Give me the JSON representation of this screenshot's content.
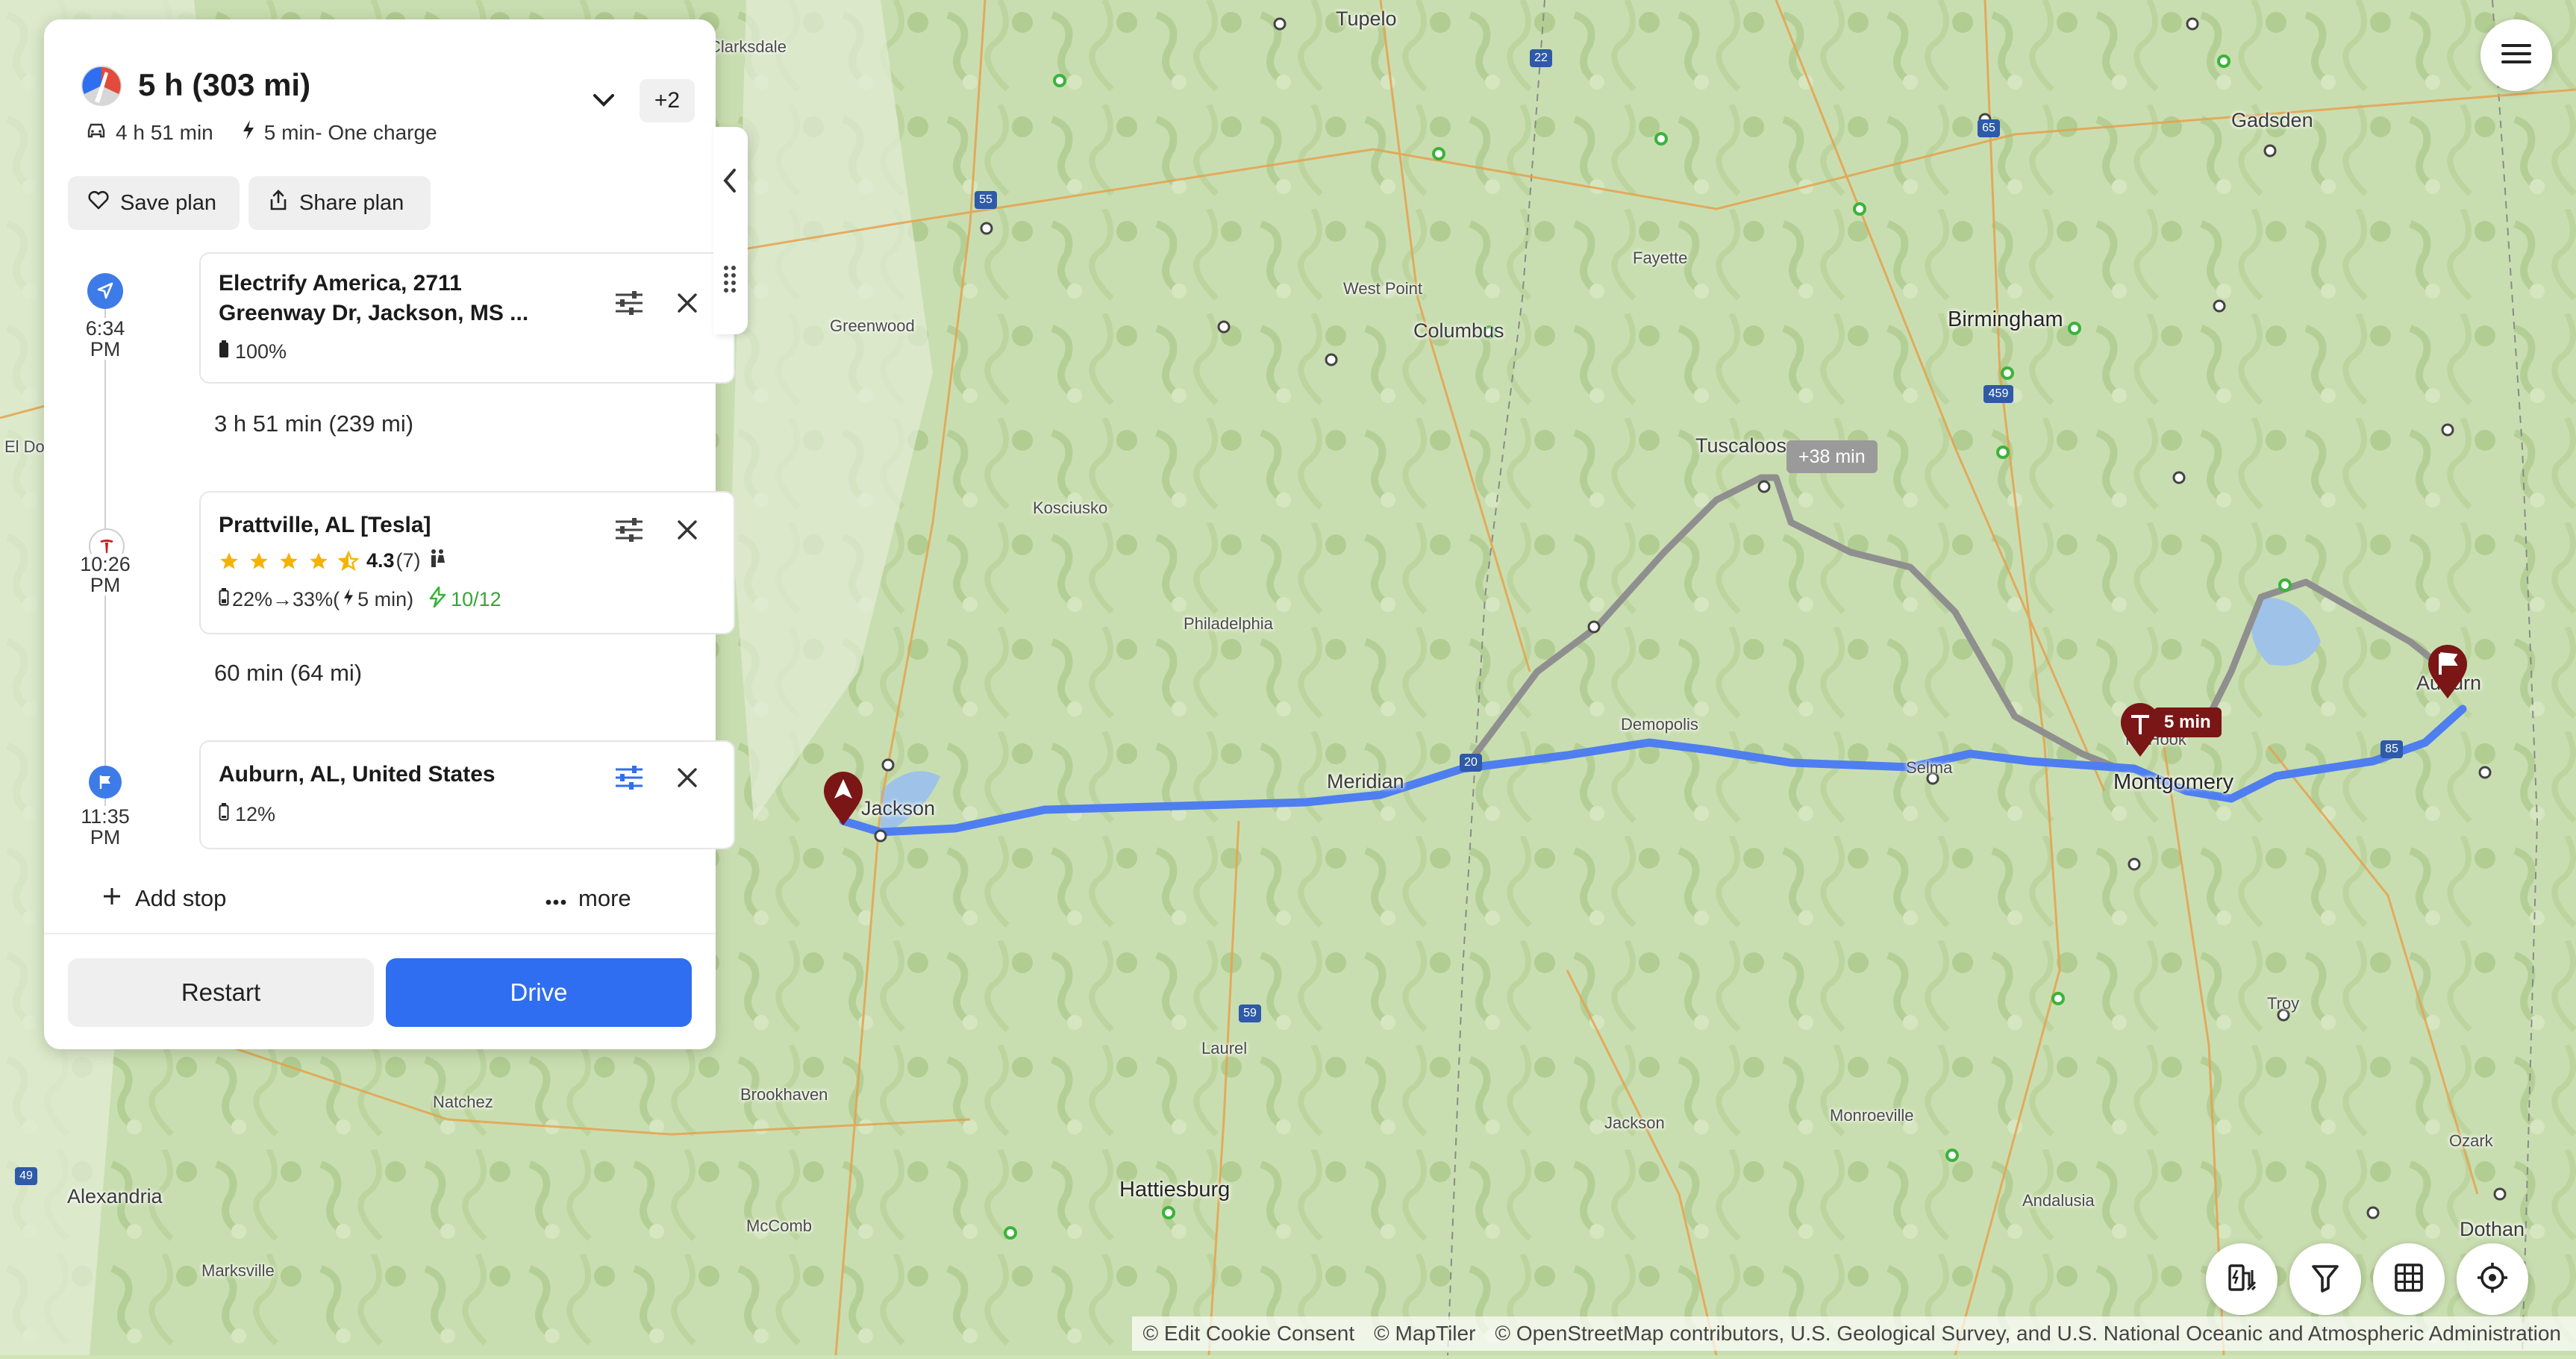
{
  "route": {
    "summary": "5 h (303 mi)",
    "drive_time": "4 h 51 min",
    "charge_info": "5 min- One charge",
    "extra_count": "+2"
  },
  "actions": {
    "save_label": "Save plan",
    "share_label": "Share plan"
  },
  "stops": [
    {
      "time": [
        "6:34",
        "PM"
      ],
      "title_line1": "Electrify America, 2711",
      "title_line2": "Greenway Dr, Jackson, MS ...",
      "battery": "100%"
    },
    {
      "time": [
        "10:26",
        "PM"
      ],
      "title_line1": "Prattville, AL [Tesla]",
      "rating": "4.3",
      "rating_count": "(7)",
      "charge_detail": "22%→33%(",
      "charge_time": "5 min)",
      "stalls": "10/12"
    },
    {
      "time": [
        "11:35",
        "PM"
      ],
      "title_line1": "Auburn, AL, United States",
      "battery": "12%"
    }
  ],
  "segments": [
    "3 h 51 min (239 mi)",
    "60 min (64 mi)"
  ],
  "footer": {
    "add_stop": "Add stop",
    "more": "more",
    "restart": "Restart",
    "drive": "Drive"
  },
  "map": {
    "alt_route_badge": "+38 min",
    "charge_badge": "5 min",
    "attribution": [
      "© Edit Cookie Consent",
      "© MapTiler",
      "© OpenStreetMap contributors, U.S. Geological Survey, and U.S. National Oceanic and Atmospheric Administration"
    ],
    "places": [
      "Tupelo",
      "Clarksdale",
      "Gadsden",
      "Birmingham",
      "Fayette",
      "West Point",
      "Columbus",
      "Greenwood",
      "Tuscaloosa",
      "Kosciusko",
      "Philadelphia",
      "El Do",
      "Jackson",
      "Meridian",
      "Demopolis",
      "Selma",
      "Montgomery",
      "Mt Hook",
      "Auburn",
      "Natchez",
      "Brookhaven",
      "Laurel",
      "Hattiesburg",
      "McComb",
      "Alexandria",
      "Marksville",
      "Jackson",
      "Monroeville",
      "Andalusia",
      "Troy",
      "Ozark",
      "Dothan"
    ],
    "highways": [
      "55",
      "22",
      "65",
      "59",
      "20",
      "85",
      "49",
      "459"
    ]
  },
  "colors": {
    "route_primary": "#4f7ef0",
    "route_alt": "#8f8f8f",
    "drive_button": "#2f6ef0",
    "marker": "#7a1616",
    "charger_green": "#3bb33b"
  }
}
